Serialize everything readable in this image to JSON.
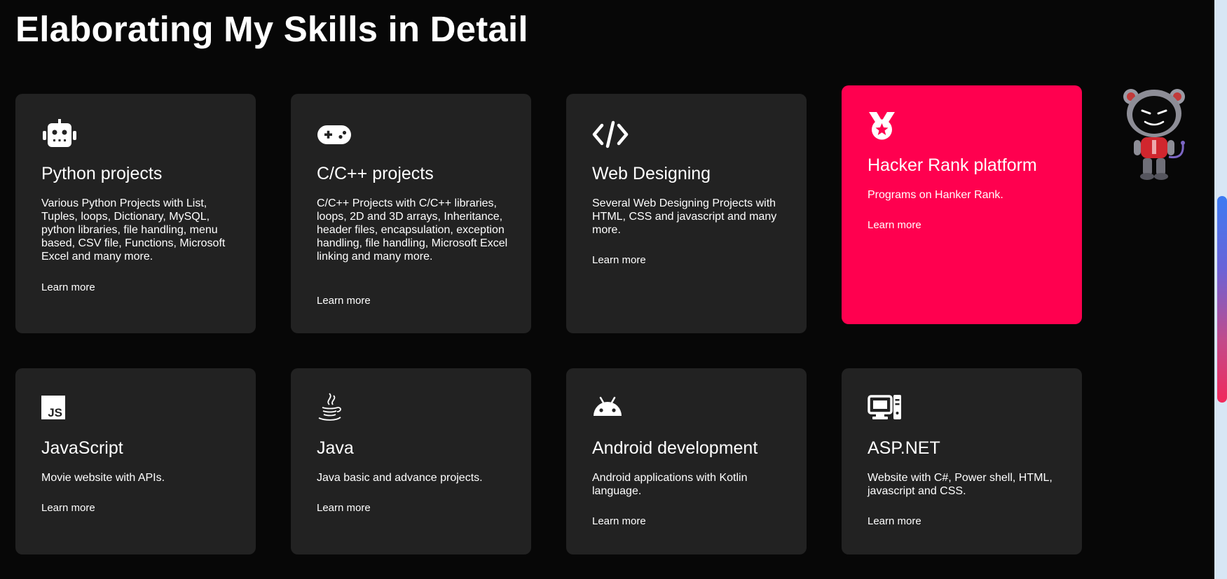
{
  "page": {
    "title": "Elaborating My Skills in Detail",
    "background_color": "#070707",
    "card_color": "#222222",
    "highlight_color": "#ff004f"
  },
  "cards": [
    {
      "icon": "robot-icon",
      "title": "Python projects",
      "description": "Various Python Projects with List, Tuples, loops, Dictionary, MySQL, python libraries, file handling, menu based, CSV file, Functions, Microsoft Excel and many more.",
      "link": "Learn more"
    },
    {
      "icon": "gamepad-icon",
      "title": "C/C++ projects",
      "description": "C/C++ Projects with C/C++ libraries, loops, 2D and 3D arrays, Inheritance, header files, encapsulation, exception handling, file handling, Microsoft Excel linking and many more.",
      "link": "Learn more"
    },
    {
      "icon": "code-icon",
      "title": "Web Designing",
      "description": "Several Web Designing Projects with HTML, CSS and javascript and many more.",
      "link": "Learn more"
    },
    {
      "icon": "medal-icon",
      "title": "Hacker Rank platform",
      "description": "Programs on Hanker Rank.",
      "link": "Learn more",
      "highlighted": true
    },
    {
      "icon": "javascript-icon",
      "title": "JavaScript",
      "description": "Movie website with APIs.",
      "link": "Learn more"
    },
    {
      "icon": "java-icon",
      "title": "Java",
      "description": "Java basic and advance projects.",
      "link": "Learn more"
    },
    {
      "icon": "android-icon",
      "title": "Android development",
      "description": "Android applications with Kotlin language.",
      "link": "Learn more"
    },
    {
      "icon": "computer-icon",
      "title": "ASP.NET",
      "description": "Website with C#, Power shell, HTML, javascript and CSS.",
      "link": "Learn more"
    }
  ],
  "icons": {
    "javascript_badge": "JS"
  },
  "mascot": {
    "icon": "robot-mascot-icon"
  }
}
